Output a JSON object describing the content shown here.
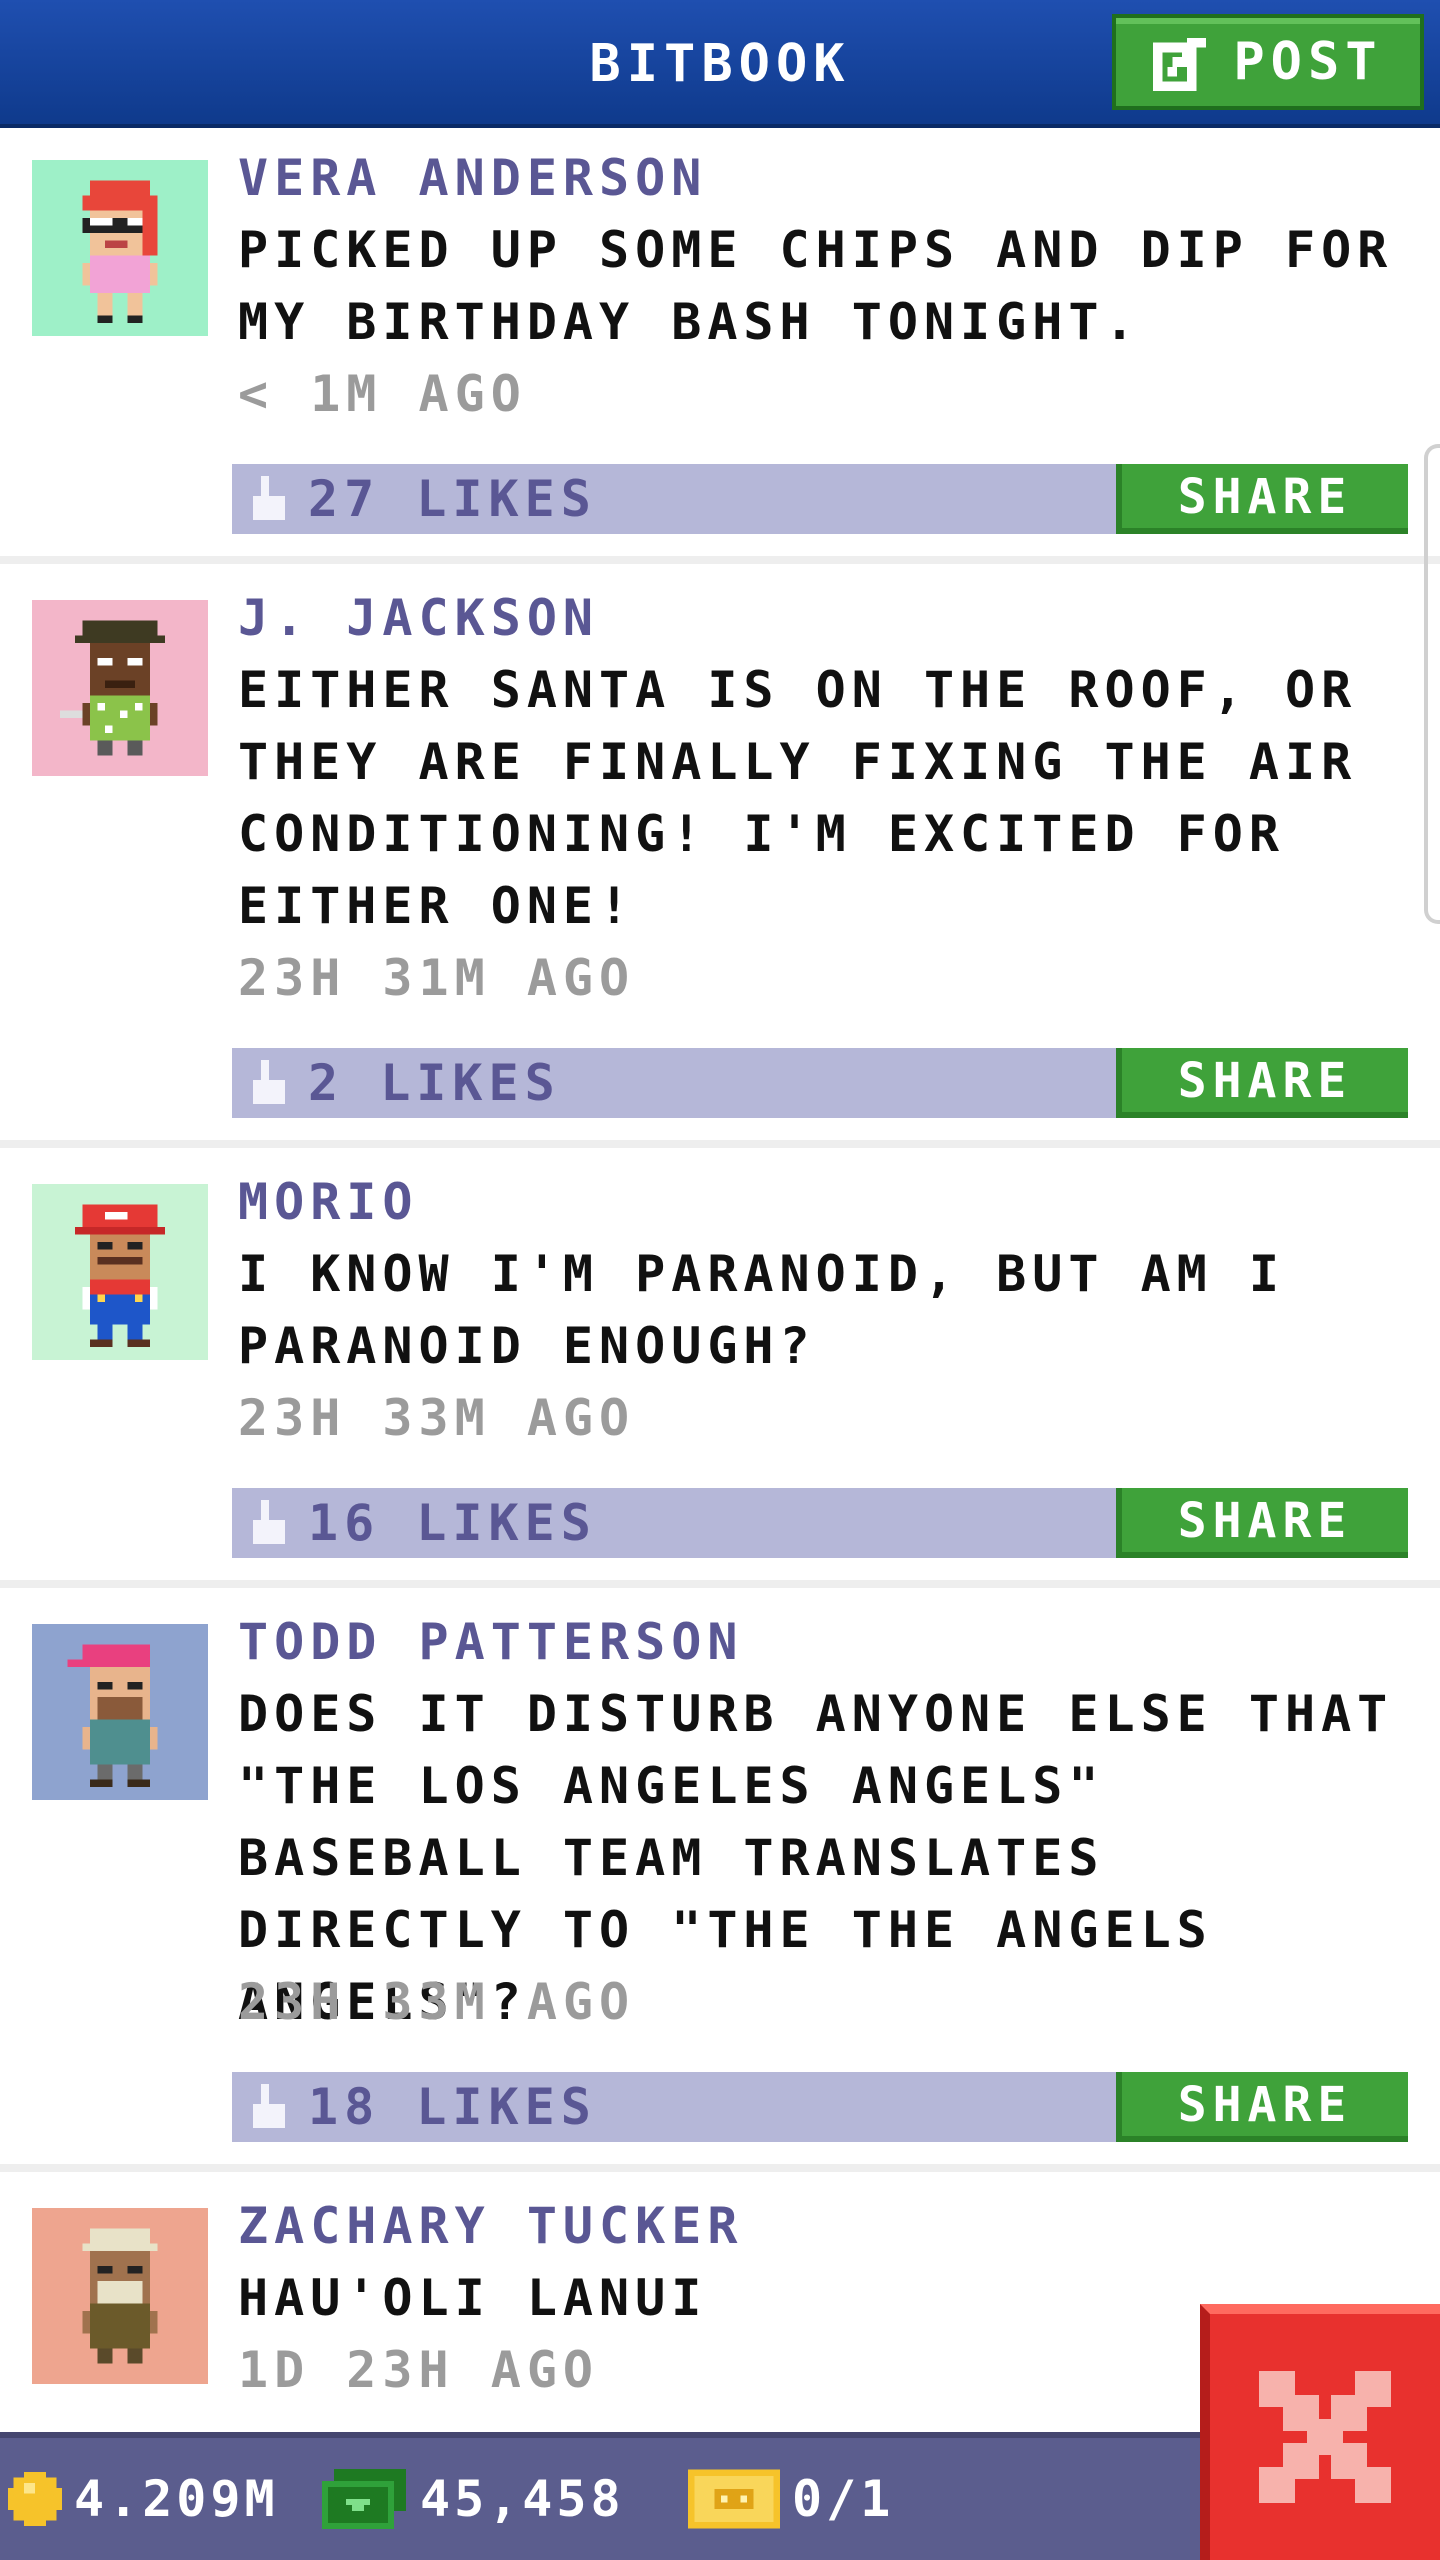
{
  "header": {
    "title": "BITBOOK",
    "post_label": "POST"
  },
  "posts": [
    {
      "author": "VERA ANDERSON",
      "text": "PICKED UP SOME CHIPS AND DIP FOR MY BIRTHDAY BASH TONIGHT.",
      "time": "< 1M AGO",
      "likes": "27 LIKES",
      "share": "SHARE",
      "avatar_bg": "#9ef0c8"
    },
    {
      "author": "J. JACKSON",
      "text": "EITHER SANTA IS ON THE ROOF, OR THEY ARE FINALLY FIXING THE AIR CONDITIONING! I'M EXCITED FOR EITHER ONE!",
      "time": "23H 31M AGO",
      "likes": "2 LIKES",
      "share": "SHARE",
      "avatar_bg": "#f3b6c9"
    },
    {
      "author": "MORIO",
      "text": "I KNOW I'M PARANOID, BUT AM I PARANOID ENOUGH?",
      "time": "23H 33M AGO",
      "likes": "16 LIKES",
      "share": "SHARE",
      "avatar_bg": "#c8f3d4"
    },
    {
      "author": "TODD PATTERSON",
      "text": "DOES IT DISTURB ANYONE ELSE THAT \"THE LOS ANGELES ANGELS\" BASEBALL TEAM TRANSLATES DIRECTLY TO \"THE THE ANGELS ANGELS\"?",
      "time": "23H 33M AGO",
      "likes": "18 LIKES",
      "share": "SHARE",
      "avatar_bg": "#8ea3cf"
    },
    {
      "author": "ZACHARY TUCKER",
      "text": "HAU'OLI LANUI",
      "time": "1D 23H AGO",
      "avatar_bg": "#eea58f"
    }
  ],
  "bottom_bar": {
    "coins": "4.209M",
    "bux": "45,458",
    "tickets": "0/1"
  },
  "icons": {
    "post": "edit-icon",
    "like": "thumbs-up-icon",
    "coin": "coin-icon",
    "bux": "cash-icon",
    "ticket": "ticket-icon",
    "close": "close-icon"
  },
  "colors": {
    "header": "#1f4fb0",
    "accent_green": "#3fa23a",
    "like_bar": "#b5b7d8",
    "author": "#5a5794",
    "close": "#e8312e"
  }
}
